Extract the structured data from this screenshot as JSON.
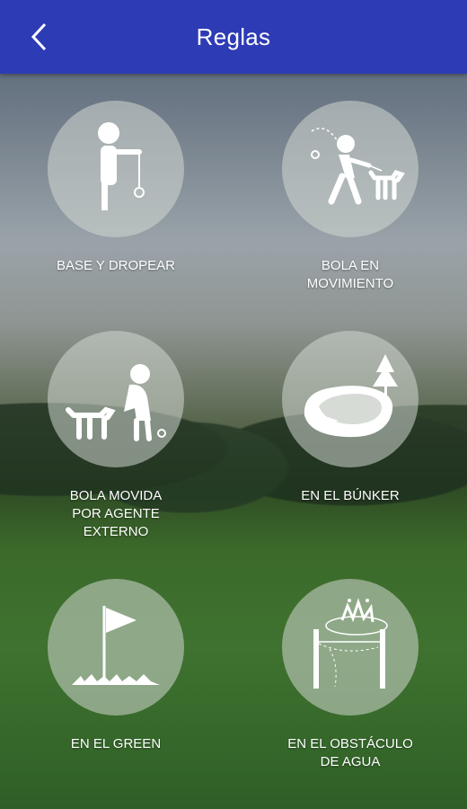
{
  "header": {
    "title": "Reglas",
    "back_icon": "chevron-left-icon"
  },
  "rules": [
    {
      "label": "BASE Y DROPEAR",
      "icon": "drop-ball-icon"
    },
    {
      "label": "BOLA EN\nMOVIMIENTO",
      "icon": "moving-ball-icon"
    },
    {
      "label": "BOLA MOVIDA\nPOR AGENTE\nEXTERNO",
      "icon": "outside-agent-icon"
    },
    {
      "label": "EN EL BÚNKER",
      "icon": "bunker-icon"
    },
    {
      "label": "EN EL GREEN",
      "icon": "green-flag-icon"
    },
    {
      "label": "EN EL OBSTÁCULO\nDE AGUA",
      "icon": "water-hazard-icon"
    }
  ]
}
